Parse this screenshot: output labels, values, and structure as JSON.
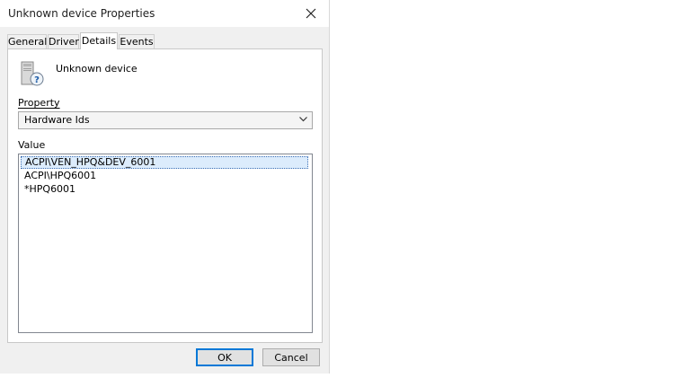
{
  "window": {
    "title": "Unknown device Properties",
    "close_icon": "close-icon"
  },
  "tabs": [
    {
      "label": "General"
    },
    {
      "label": "Driver"
    },
    {
      "label": "Details",
      "active": true
    },
    {
      "label": "Events"
    }
  ],
  "device": {
    "icon": "unknown-device-icon",
    "name": "Unknown device"
  },
  "property": {
    "label": "Property",
    "selected": "Hardware Ids"
  },
  "value": {
    "label": "Value",
    "items": [
      {
        "text": "ACPI\\VEN_HPQ&DEV_6001",
        "selected": true
      },
      {
        "text": "ACPI\\HPQ6001"
      },
      {
        "text": "*HPQ6001"
      }
    ]
  },
  "buttons": {
    "ok_label": "OK",
    "cancel_label": "Cancel"
  },
  "colors": {
    "dialog_bg": "#f0f0f0",
    "selection_bg": "#dcecfc",
    "default_button_border": "#0078d7"
  }
}
